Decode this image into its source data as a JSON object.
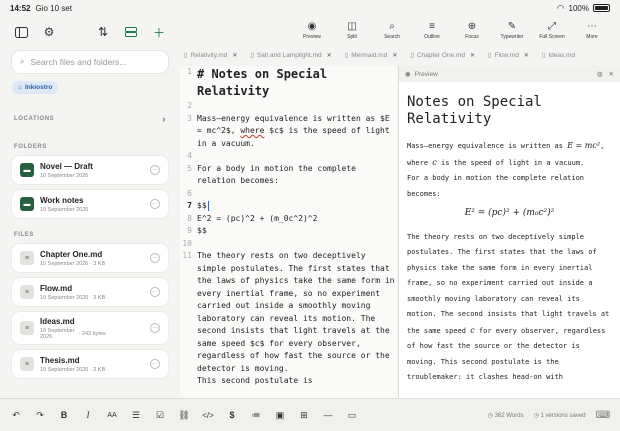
{
  "status": {
    "time": "14:52",
    "date": "Gio 10 set",
    "battery": "100%"
  },
  "sidebar": {
    "search_placeholder": "Search files and folders...",
    "chip": "Inkiostro",
    "locations_label": "LOCATIONS",
    "folders_label": "FOLDERS",
    "files_label": "FILES",
    "folders": [
      {
        "name": "Novel — Draft",
        "meta": "10 September 2026"
      },
      {
        "name": "Work notes",
        "meta": "10 September 2026"
      }
    ],
    "files": [
      {
        "name": "Chapter One.md",
        "meta": "10 September 2026 · 3 KB"
      },
      {
        "name": "Flow.md",
        "meta": "10 September 2026 · 3 KB"
      },
      {
        "name": "Ideas.md",
        "meta1": "10 September",
        "meta2": "2026",
        "size": "· 243 bytes"
      },
      {
        "name": "Thesis.md",
        "meta": "10 September 2026 · 2 KB"
      }
    ]
  },
  "toolbar": {
    "preview": "Preview",
    "split": "Split",
    "search": "Search",
    "outline": "Outline",
    "focus": "Focus",
    "typewriter": "Typewriter",
    "fullscreen": "Full Screen",
    "more": "More"
  },
  "tabs": [
    "Relativity.md",
    "Salt and Lamplight.md",
    "Mermaid.md",
    "Chapter One.md",
    "Flow.md",
    "Ideas.md"
  ],
  "editor": {
    "l1": "# Notes on Special Relativity",
    "l3": "Mass–energy equivalence is written as $E = mc^2$, ",
    "l3w": "where",
    "l3b": " $c$ is the speed of light in a vacuum.",
    "l5": "For a body in motion the complete relation becomes:",
    "l7": "$$",
    "l8": "E^2 = (pc)^2 + (m_0c^2)^2",
    "l9": "$$",
    "l11": "The theory rests on two deceptively simple postulates. The first states that the laws of physics take the same form in every inertial frame, so no experiment carried out inside a smoothly moving laboratory can reveal its motion. The second insists that light travels at the same speed $c$ for every observer, regardless of how fast the source or the detector is moving.",
    "l11b": "This second postulate is"
  },
  "preview": {
    "label": "Preview",
    "title": "Notes on Special Relativity",
    "p1a": "Mass–energy equivalence is written as ",
    "p1m": "E = mc²",
    "p1b": ", where ",
    "p1c": "c",
    "p1d": " is the speed of light in a vacuum.",
    "p2": "For a body in motion the complete relation becomes:",
    "eq": "E² = (pc)² + (m₀c²)²",
    "p3a": "The theory rests on two deceptively simple postulates. The first states that the laws of physics take the same form in every inertial frame, so no experiment carried out inside a smoothly moving laboratory can reveal its motion. The second insists that light travels at the same speed ",
    "p3c": "c",
    "p3b": " for every observer, regardless of how fast the source or the detector is moving. This second postulate is the troublemaker: it clashes head-on with"
  },
  "bottom": {
    "words": "362 Words",
    "versions": "1 versions saved"
  }
}
